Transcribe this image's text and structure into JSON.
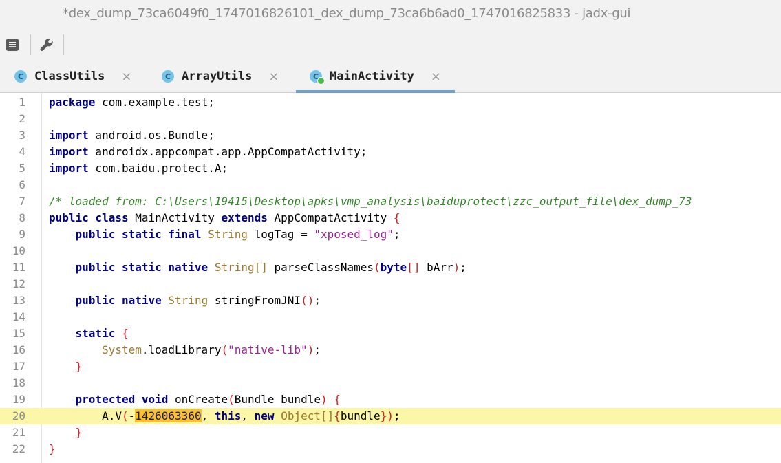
{
  "window": {
    "title": "*dex_dump_73ca6049f0_1747016826101_dex_dump_73ca6b6ad0_1747016825833 - jadx-gui"
  },
  "toolbar": {
    "buttons": [
      "menu-icon",
      "wrench-icon"
    ]
  },
  "tabs": [
    {
      "label": "ClassUtils",
      "icon": "C",
      "active": false
    },
    {
      "label": "ArrayUtils",
      "icon": "C",
      "active": false
    },
    {
      "label": "MainActivity",
      "icon": "C",
      "active": true
    }
  ],
  "tab_close_glyph": "×",
  "code": {
    "lines": [
      {
        "n": "1"
      },
      {
        "n": "2"
      },
      {
        "n": "3"
      },
      {
        "n": "4"
      },
      {
        "n": "5"
      },
      {
        "n": "6"
      },
      {
        "n": "7"
      },
      {
        "n": "8"
      },
      {
        "n": "9"
      },
      {
        "n": "10"
      },
      {
        "n": "11"
      },
      {
        "n": "12"
      },
      {
        "n": "13"
      },
      {
        "n": "14"
      },
      {
        "n": "15"
      },
      {
        "n": "16"
      },
      {
        "n": "17"
      },
      {
        "n": "18"
      },
      {
        "n": "19"
      },
      {
        "n": "20"
      },
      {
        "n": "21"
      },
      {
        "n": "22"
      }
    ],
    "t": {
      "l1": [
        "package",
        " com.example.test;"
      ],
      "l3": [
        "import",
        " android.os.Bundle;"
      ],
      "l4": [
        "import",
        " androidx.appcompat.app.AppCompatActivity;"
      ],
      "l5": [
        "import",
        " com.baidu.protect.A;"
      ],
      "l7": "/* loaded from: C:\\Users\\19415\\Desktop\\apks\\vmp_analysis\\baiduprotect\\zzc_output_file\\dex_dump_73",
      "l8": [
        "public class",
        " MainActivity ",
        "extends",
        " AppCompatActivity ",
        "{"
      ],
      "l9": [
        "    ",
        "public static final",
        " ",
        "String",
        " logTag = ",
        "\"xposed_log\"",
        ";"
      ],
      "l11": [
        "    ",
        "public static native",
        " ",
        "String[]",
        " parseClassNames",
        "(",
        "byte",
        "[]",
        " bArr",
        ")",
        ";"
      ],
      "l13": [
        "    ",
        "public native",
        " ",
        "String",
        " stringFromJNI",
        "()",
        ";"
      ],
      "l15": [
        "    ",
        "static",
        " ",
        "{"
      ],
      "l16": [
        "        ",
        "System",
        ".loadLibrary",
        "(",
        "\"native-lib\"",
        ")",
        ";"
      ],
      "l17": [
        "    ",
        "}"
      ],
      "l19": [
        "    ",
        "protected void",
        " onCreate",
        "(",
        "Bundle bundle",
        ")",
        " ",
        "{"
      ],
      "l20": [
        "        A.V",
        "(",
        "-",
        "1426063360",
        ", ",
        "this",
        ", ",
        "new",
        " ",
        "Object[]",
        "{",
        "bundle",
        "}",
        ")",
        ";"
      ],
      "l21": [
        "    ",
        "}"
      ],
      "l22": [
        "}"
      ]
    },
    "highlighted_line": "20"
  }
}
